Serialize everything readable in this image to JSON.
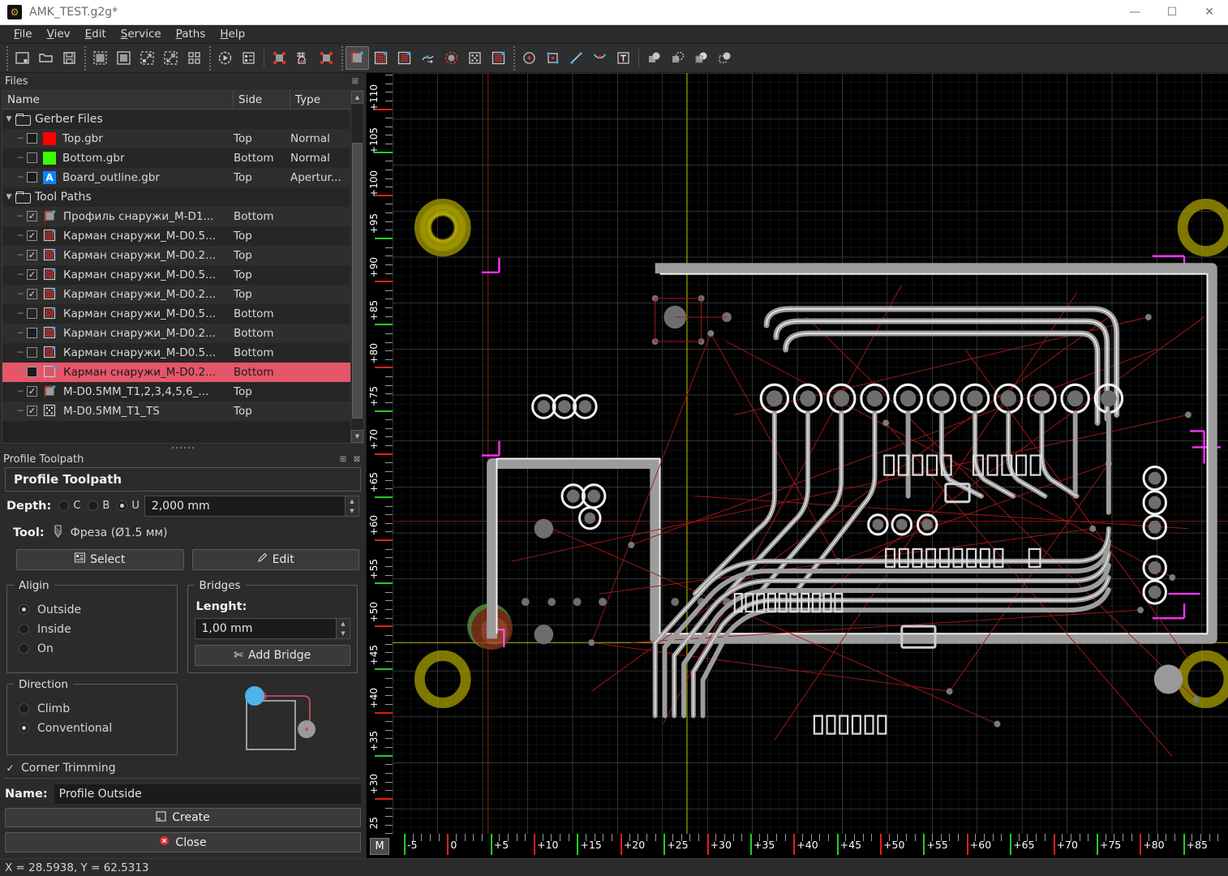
{
  "window": {
    "title": "AMK_TEST.g2g*",
    "app_icon": "app-logo-icon",
    "minimize": "—",
    "maximize": "☐",
    "close": "✕"
  },
  "menu": [
    {
      "label": "File",
      "accel": "F"
    },
    {
      "label": "Viev",
      "accel": "V"
    },
    {
      "label": "Edit",
      "accel": "E"
    },
    {
      "label": "Service",
      "accel": "S"
    },
    {
      "label": "Paths",
      "accel": "P"
    },
    {
      "label": "Help",
      "accel": "H"
    }
  ],
  "toolbar": [
    {
      "name": "new-file-icon",
      "group": 1
    },
    {
      "name": "open-file-icon",
      "group": 1
    },
    {
      "name": "save-file-icon",
      "group": 1
    },
    {
      "name": "zoom-fit-icon",
      "group": 2
    },
    {
      "name": "zoom-selection-icon",
      "group": 2
    },
    {
      "name": "zoom-in-icon",
      "group": 2
    },
    {
      "name": "zoom-out-icon",
      "group": 2
    },
    {
      "name": "grid-icon",
      "group": 2
    },
    {
      "name": "simulate-icon",
      "group": 3
    },
    {
      "name": "properties-list-icon",
      "group": 3
    },
    {
      "name": "drill-points-icon",
      "group": 4
    },
    {
      "name": "home-grid-icon",
      "group": 4
    },
    {
      "name": "zero-point-icon",
      "group": 4
    },
    {
      "name": "profile-toolpath-icon",
      "group": 5,
      "active": true
    },
    {
      "name": "pocket-outside-icon",
      "group": 5
    },
    {
      "name": "pocket-raster-icon",
      "group": 5
    },
    {
      "name": "thermal-icon",
      "group": 5
    },
    {
      "name": "drill-circle-icon",
      "group": 5
    },
    {
      "name": "drill-array-icon",
      "group": 5
    },
    {
      "name": "hatch-icon",
      "group": 5
    },
    {
      "name": "point-icon",
      "group": 6
    },
    {
      "name": "rectangle-icon",
      "group": 6
    },
    {
      "name": "line-icon",
      "group": 6
    },
    {
      "name": "arc-icon",
      "group": 6
    },
    {
      "name": "text-icon",
      "group": 6
    },
    {
      "name": "boolean-union-icon",
      "group": 7
    },
    {
      "name": "boolean-subtract-icon",
      "group": 7
    },
    {
      "name": "boolean-intersect-icon",
      "group": 7
    },
    {
      "name": "boolean-xor-icon",
      "group": 7
    }
  ],
  "files_dock": {
    "title": "Files",
    "float_icon": "float-dock-icon",
    "columns": [
      "Name",
      "Side",
      "Type"
    ],
    "rows": [
      {
        "depth": 0,
        "expander": "▼",
        "icon": "folder-icon",
        "name": "Gerber Files",
        "side": "",
        "type": "",
        "kind": "folder"
      },
      {
        "depth": 1,
        "checkbox": "filled",
        "swatch": "#ff0000",
        "name": "Top.gbr",
        "side": "Top",
        "type": "Normal",
        "kind": "gerber"
      },
      {
        "depth": 1,
        "checkbox": "empty",
        "swatch": "#3dff00",
        "name": "Bottom.gbr",
        "side": "Bottom",
        "type": "Normal",
        "kind": "gerber"
      },
      {
        "depth": 1,
        "checkbox": "filled",
        "swatch": "#0a84ff",
        "swatch_label": "A",
        "name": "Board_outline.gbr",
        "side": "Top",
        "type": "Apertur...",
        "kind": "gerber"
      },
      {
        "depth": 0,
        "expander": "▼",
        "icon": "folder-icon",
        "name": "Tool Paths",
        "side": "",
        "type": "",
        "kind": "folder"
      },
      {
        "depth": 1,
        "checkbox": "checked",
        "icon": "profile-path-icon",
        "name": "Профиль снаружи_M-D1...",
        "side": "Bottom",
        "type": "",
        "kind": "path"
      },
      {
        "depth": 1,
        "checkbox": "checked",
        "icon": "pocket-path-icon",
        "name": "Карман снаружи_M-D0.5...",
        "side": "Top",
        "type": "",
        "kind": "path"
      },
      {
        "depth": 1,
        "checkbox": "checked",
        "icon": "pocket-path-icon",
        "name": "Карман снаружи_M-D0.2...",
        "side": "Top",
        "type": "",
        "kind": "path"
      },
      {
        "depth": 1,
        "checkbox": "checked",
        "icon": "pocket-path-icon",
        "name": "Карман снаружи_M-D0.5...",
        "side": "Top",
        "type": "",
        "kind": "path"
      },
      {
        "depth": 1,
        "checkbox": "checked",
        "icon": "pocket-path-icon",
        "name": "Карман снаружи_M-D0.2...",
        "side": "Top",
        "type": "",
        "kind": "path"
      },
      {
        "depth": 1,
        "checkbox": "empty",
        "icon": "pocket-path-icon",
        "name": "Карман снаружи_M-D0.5...",
        "side": "Bottom",
        "type": "",
        "kind": "path"
      },
      {
        "depth": 1,
        "checkbox": "filled",
        "icon": "pocket-path-icon",
        "name": "Карман снаружи_M-D0.2...",
        "side": "Bottom",
        "type": "",
        "kind": "path"
      },
      {
        "depth": 1,
        "checkbox": "empty",
        "icon": "pocket-path-icon",
        "name": "Карман снаружи_M-D0.5...",
        "side": "Bottom",
        "type": "",
        "kind": "path"
      },
      {
        "depth": 1,
        "checkbox": "filled",
        "icon": "pocket-path-icon",
        "name": "Карман снаружи_M-D0.2...",
        "side": "Bottom",
        "type": "",
        "kind": "path",
        "selected": true
      },
      {
        "depth": 1,
        "checkbox": "checked",
        "icon": "profile-path-icon",
        "name": "M-D0.5MM_T1,2,3,4,5,6_...",
        "side": "Top",
        "type": "",
        "kind": "path"
      },
      {
        "depth": 1,
        "checkbox": "checked",
        "icon": "drill-path-icon",
        "name": "M-D0.5MM_T1_TS",
        "side": "Top",
        "type": "",
        "kind": "path"
      }
    ]
  },
  "properties": {
    "dock_title": "Profile Toolpath",
    "restore_icon": "restore-dock-icon",
    "close_icon": "close-dock-icon",
    "heading": "Profile Toolpath",
    "depth_label": "Depth:",
    "depth_modes": [
      {
        "label": "C",
        "selected": false
      },
      {
        "label": "B",
        "selected": false
      },
      {
        "label": "U",
        "selected": true
      }
    ],
    "depth_value": "2,000 mm",
    "tool_label": "Tool:",
    "tool_icon": "end-mill-icon",
    "tool_value": "Фреза (Ø1.5 мм)",
    "select_button": "Select",
    "select_icon": "list-select-icon",
    "edit_button": "Edit",
    "edit_icon": "pencil-icon",
    "align_group": "Aligin",
    "align_options": [
      {
        "label": "Outside",
        "selected": true
      },
      {
        "label": "Inside",
        "selected": false
      },
      {
        "label": "On",
        "selected": false
      }
    ],
    "bridges_group": "Bridges",
    "bridges_length_label": "Lenght:",
    "bridges_length_value": "1,00 mm",
    "add_bridge_button": "Add Bridge",
    "add_bridge_icon": "scissors-icon",
    "direction_group": "Direction",
    "direction_options": [
      {
        "label": "Climb",
        "selected": false
      },
      {
        "label": "Conventional",
        "selected": true
      }
    ],
    "corner_trimming_label": "Corner Trimming",
    "corner_trimming_checked": true,
    "preview_icon": "toolpath-preview-diagram",
    "name_label": "Name:",
    "name_value": "Profile Outside",
    "create_button": "Create",
    "create_icon": "create-icon",
    "close_button": "Close",
    "close_button_icon": "close-circle-icon"
  },
  "canvas": {
    "origin_button": "M",
    "v_ruler_labels": [
      "+110",
      "+105",
      "+100",
      "+95",
      "+90",
      "+85",
      "+80",
      "+75",
      "+70",
      "+65",
      "+60",
      "+55",
      "+50",
      "+45",
      "+40",
      "+35",
      "+30",
      "25"
    ],
    "h_ruler_labels": [
      "-5",
      "0",
      "+5",
      "+10",
      "+15",
      "+20",
      "+25",
      "+30",
      "+35",
      "+40",
      "+45",
      "+50",
      "+55",
      "+60",
      "+65",
      "+70",
      "+75",
      "+80",
      "+85"
    ],
    "colors": {
      "background": "#000000",
      "grid_minor": "#1d1d1d",
      "grid_major": "#585858",
      "toolpath_fill": "#9a9a9a",
      "toolpath_outline": "#f2f2f2",
      "ratline": "#c01f1f",
      "fiducial": "#b8b000",
      "origin_cross_x": "#d42020",
      "origin_cross_y": "#c8c800",
      "mark_magenta": "#ff30ff",
      "tick_red": "#e02020",
      "tick_green": "#20d020"
    }
  },
  "status": {
    "coordinates": "X = 28.5938, Y = 62.5313"
  }
}
